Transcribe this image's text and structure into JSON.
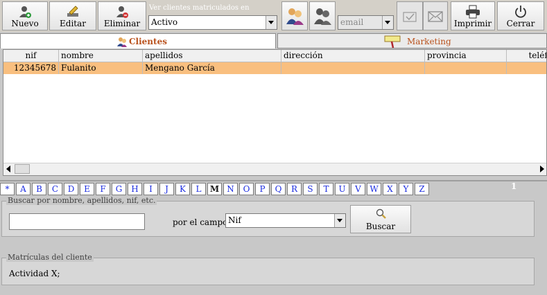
{
  "toolbar": {
    "nuevo_label": "Nuevo",
    "editar_label": "Editar",
    "eliminar_label": "Eliminar",
    "ver_caption": "Ver clientes matriculados en",
    "ver_selected": "Activo",
    "email_placeholder": "email",
    "imprimir_label": "Imprimir",
    "cerrar_label": "Cerrar"
  },
  "tabs": [
    {
      "label": "Clientes",
      "active": true,
      "icon": "users-icon"
    },
    {
      "label": "Marketing",
      "active": false,
      "icon": "megaphone-icon"
    }
  ],
  "grid": {
    "columns": [
      "nif",
      "nombre",
      "apellidos",
      "dirección",
      "provincia",
      "teléfo"
    ],
    "rows": [
      {
        "nif": "12345678",
        "nombre": "Fulanito",
        "apellidos": "Mengano García",
        "direccion": "",
        "provincia": "",
        "telefono": ""
      }
    ],
    "selected_row_color": "#f9bf7f"
  },
  "letters": [
    "*",
    "A",
    "B",
    "C",
    "D",
    "E",
    "F",
    "G",
    "H",
    "I",
    "J",
    "K",
    "L",
    "M",
    "N",
    "O",
    "P",
    "Q",
    "R",
    "S",
    "T",
    "U",
    "V",
    "W",
    "X",
    "Y",
    "Z"
  ],
  "selected_letter": "M",
  "page_number": "1",
  "search": {
    "legend": "Buscar por nombre, apellidos, nif, etc.",
    "value": "",
    "field_label": "por el campo",
    "field_selected": "Nif",
    "button_label": "Buscar"
  },
  "matriculas": {
    "legend": "Matrículas del cliente",
    "value": "Actividad X;"
  },
  "colors": {
    "accent": "#b9511c",
    "letter_link": "#1c2de0",
    "background": "#c8c8c8"
  }
}
